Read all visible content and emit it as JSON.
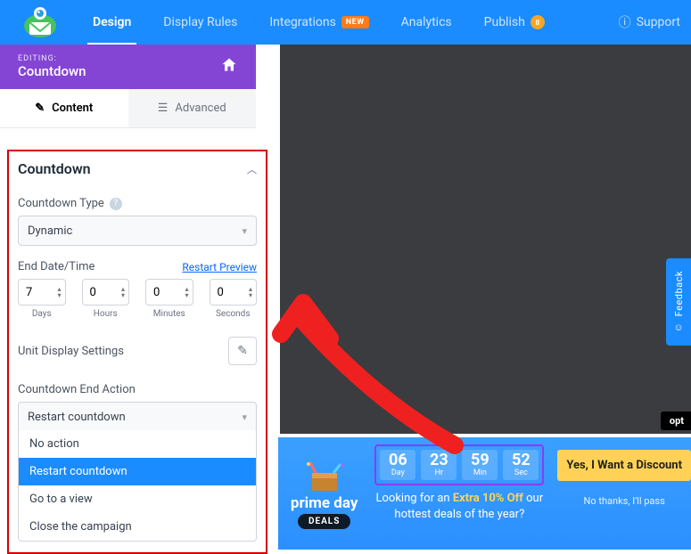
{
  "topnav": {
    "tabs": [
      "Design",
      "Display Rules",
      "Integrations",
      "Analytics",
      "Publish"
    ],
    "new_badge": "NEW",
    "pause_badge": "II",
    "support": "Support"
  },
  "editing": {
    "label": "EDITING:",
    "name": "Countdown"
  },
  "side_tabs": {
    "content": "Content",
    "advanced": "Advanced"
  },
  "panel": {
    "title": "Countdown",
    "type_label": "Countdown Type",
    "type_value": "Dynamic",
    "end_label": "End Date/Time",
    "restart_link": "Restart Preview",
    "units": [
      {
        "value": "7",
        "label": "Days"
      },
      {
        "value": "0",
        "label": "Hours"
      },
      {
        "value": "0",
        "label": "Minutes"
      },
      {
        "value": "0",
        "label": "Seconds"
      }
    ],
    "unit_display_label": "Unit Display Settings",
    "end_action_label": "Countdown End Action",
    "end_action_value": "Restart countdown",
    "end_action_options": [
      "No action",
      "Restart countdown",
      "Go to a view",
      "Close the campaign"
    ],
    "selected_option_index": 1
  },
  "feedback": "Feedback",
  "opt_pill": "opt",
  "promo": {
    "brand": "prime day",
    "deals": "DEALS",
    "timer": [
      {
        "value": "06",
        "label": "Day"
      },
      {
        "value": "23",
        "label": "Hr"
      },
      {
        "value": "59",
        "label": "Min"
      },
      {
        "value": "52",
        "label": "Sec"
      }
    ],
    "line1": "Looking for an ",
    "extra": "Extra 10% Off",
    "line2": " our hottest deals of the year?",
    "cta": "Yes, I Want a Discount",
    "nothanks": "No thanks, I'll pass"
  }
}
